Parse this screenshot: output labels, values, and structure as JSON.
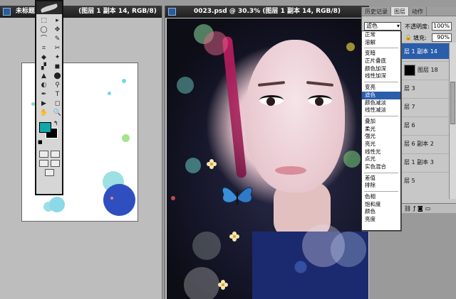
{
  "left_doc": {
    "title": "未标题",
    "title_suffix": "(图层 1 副本 14, RGB/8)"
  },
  "main_doc": {
    "title": "0023.psd @ 30.3% (图层 1 副本 14, RGB/8)"
  },
  "colors": {
    "foreground": "#13a7a9",
    "background": "#000000",
    "selection": "#2a5daa"
  },
  "toolbox": {
    "tools": [
      "⬚",
      "▸",
      "◯",
      "✥",
      "⌒",
      "✎",
      "⌗",
      "✂",
      "◆",
      "✦",
      "▞",
      "◼",
      "▲",
      "⬤",
      "◐",
      "⚲",
      "✒",
      "T",
      "▶",
      "◻",
      "✋",
      "🔍"
    ],
    "swap_icon": "↰",
    "default_icon": "■"
  },
  "panel": {
    "tabs": [
      "历史记录",
      "图层",
      "动作"
    ],
    "blend_mode": "滤色",
    "opacity_label": "不透明度:",
    "opacity_value": "100%",
    "fill_label": "填充:",
    "fill_value": "90%",
    "layers": [
      {
        "name": "层 1 副本 14",
        "selected": true
      },
      {
        "name": "图层 18",
        "selected": false,
        "has_thumb": true
      },
      {
        "name": "层 3",
        "selected": false
      },
      {
        "name": "层 7",
        "selected": false
      },
      {
        "name": "层 6",
        "selected": false
      },
      {
        "name": "层 6 副本 2",
        "selected": false
      },
      {
        "name": "层 1 副本 3",
        "selected": false
      },
      {
        "name": "层 5",
        "selected": false
      }
    ]
  },
  "blend_modes": {
    "group1": [
      "正常",
      "溶解"
    ],
    "group2": [
      "变暗",
      "正片叠底",
      "颜色加深",
      "线性加深"
    ],
    "group3": [
      "变亮",
      "滤色",
      "颜色减淡",
      "线性减淡"
    ],
    "group4": [
      "叠加",
      "柔光",
      "强光",
      "亮光",
      "线性光",
      "点光",
      "实色混合"
    ],
    "group5": [
      "差值",
      "排除"
    ],
    "group6": [
      "色相",
      "饱和度",
      "颜色",
      "亮度"
    ],
    "selected": "滤色"
  }
}
